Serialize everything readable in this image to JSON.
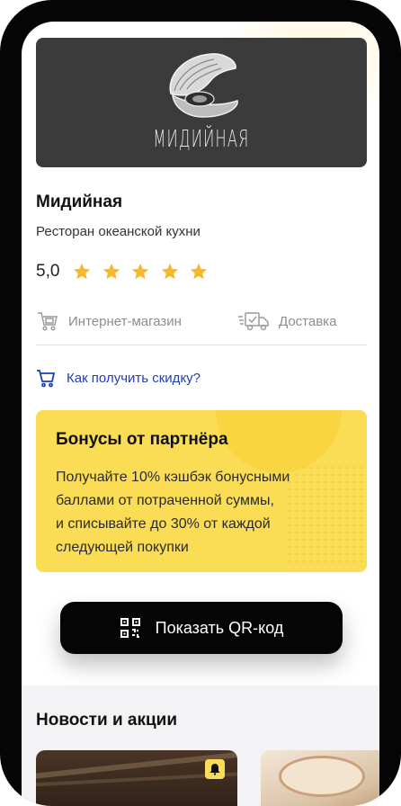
{
  "store": {
    "logo_text": "МИДИЙНАЯ",
    "name": "Мидийная",
    "description": "Ресторан океанской кухни",
    "rating": "5,0",
    "stars": 5
  },
  "meta": {
    "online_shop": "Интернет-магазин",
    "delivery": "Доставка"
  },
  "discount_link": "Как получить скидку?",
  "bonus": {
    "title": "Бонусы от партнёра",
    "text": "Получайте 10% кэшбэк бонусными\nбаллами от потраченной суммы,\nи списывайте до 30% от каждой\nследующей покупки"
  },
  "qr_button": "Показать QR-код",
  "news": {
    "title": "Новости и акции"
  },
  "colors": {
    "accent_yellow": "#fbdc55",
    "star": "#f5b82e",
    "link_blue": "#1f3fb4",
    "dark": "#050505"
  },
  "icons": {
    "star": "star-icon",
    "cart": "shopping-cart-icon",
    "truck": "delivery-truck-icon",
    "qr": "qr-code-icon",
    "bell": "bell-icon"
  }
}
